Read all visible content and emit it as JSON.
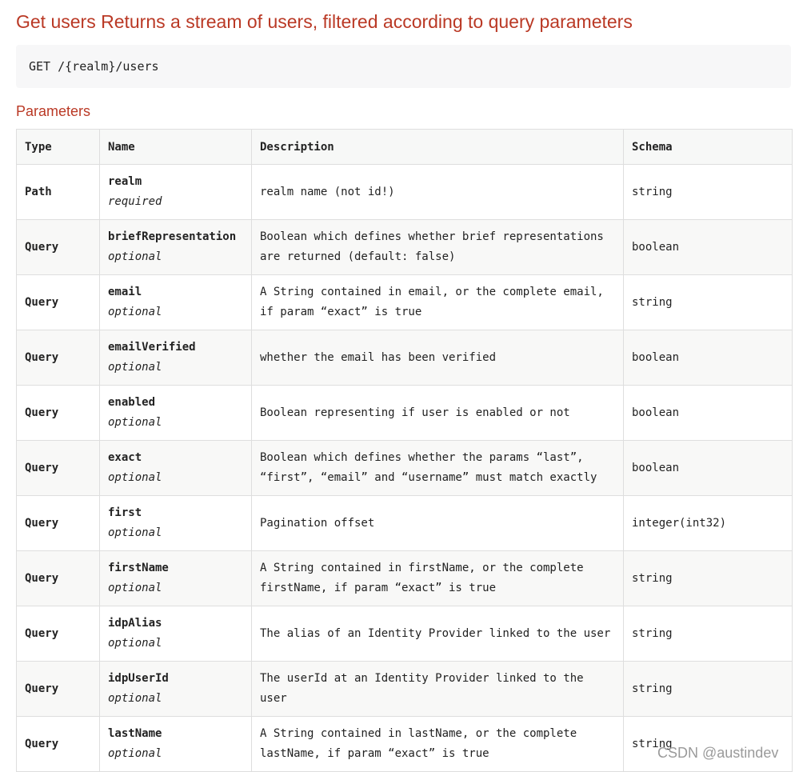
{
  "page": {
    "title": "Get users Returns a stream of users, filtered according to query parameters",
    "endpoint": "GET /{realm}/users",
    "section_title": "Parameters",
    "watermark": "CSDN @austindev"
  },
  "table": {
    "headers": [
      "Type",
      "Name",
      "Description",
      "Schema"
    ],
    "rows": [
      {
        "type": "Path",
        "name": "realm",
        "requirement": "required",
        "description": "realm name (not id!)",
        "schema": "string"
      },
      {
        "type": "Query",
        "name": "briefRepresentation",
        "requirement": "optional",
        "description": "Boolean which defines whether brief representations are returned (default: false)",
        "schema": "boolean"
      },
      {
        "type": "Query",
        "name": "email",
        "requirement": "optional",
        "description": "A String contained in email, or the complete email, if param “exact” is true",
        "schema": "string"
      },
      {
        "type": "Query",
        "name": "emailVerified",
        "requirement": "optional",
        "description": "whether the email has been verified",
        "schema": "boolean"
      },
      {
        "type": "Query",
        "name": "enabled",
        "requirement": "optional",
        "description": "Boolean representing if user is enabled or not",
        "schema": "boolean"
      },
      {
        "type": "Query",
        "name": "exact",
        "requirement": "optional",
        "description": "Boolean which defines whether the params “last”, “first”, “email” and “username” must match exactly",
        "schema": "boolean"
      },
      {
        "type": "Query",
        "name": "first",
        "requirement": "optional",
        "description": "Pagination offset",
        "schema": "integer(int32)"
      },
      {
        "type": "Query",
        "name": "firstName",
        "requirement": "optional",
        "description": "A String contained in firstName, or the complete firstName, if param “exact” is true",
        "schema": "string"
      },
      {
        "type": "Query",
        "name": "idpAlias",
        "requirement": "optional",
        "description": "The alias of an Identity Provider linked to the user",
        "schema": "string"
      },
      {
        "type": "Query",
        "name": "idpUserId",
        "requirement": "optional",
        "description": "The userId at an Identity Provider linked to the user",
        "schema": "string"
      },
      {
        "type": "Query",
        "name": "lastName",
        "requirement": "optional",
        "description": "A String contained in lastName, or the complete lastName, if param “exact” is true",
        "schema": "string"
      }
    ]
  }
}
